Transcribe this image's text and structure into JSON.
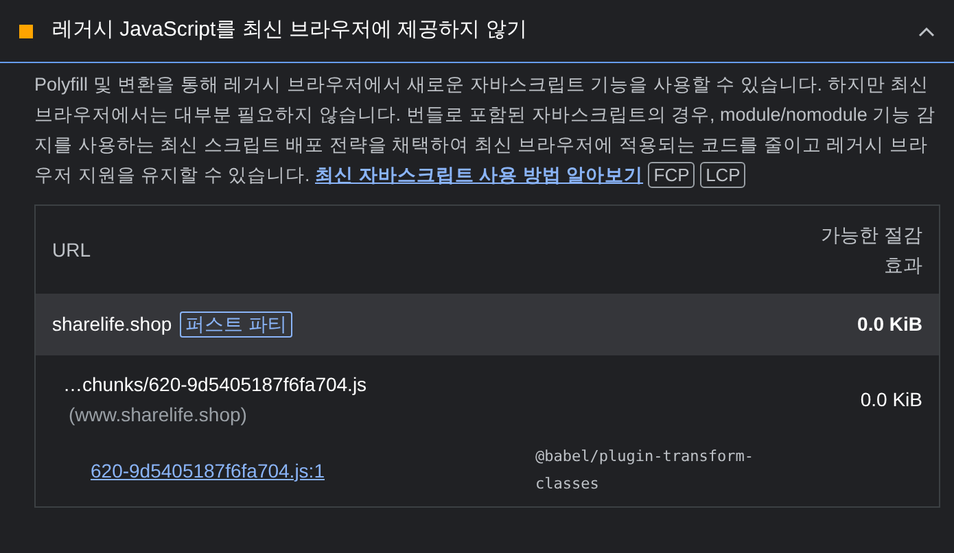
{
  "audit": {
    "title": "레거시 JavaScript를 최신 브라우저에 제공하지 않기",
    "expanded": true,
    "passed": false
  },
  "description": {
    "text": "Polyfill 및 변환을 통해 레거시 브라우저에서 새로운 자바스크립트 기능을 사용할 수 있습니다. 하지만 최신 브라우저에서는 대부분 필요하지 않습니다. 번들로 포함된 자바스크립트의 경우, module/nomodule 기능 감지를 사용하는 최신 스크립트 배포 전략을 채택하여 최신 브라우저에 적용되는 코드를 줄이고 레거시 브라우저 지원을 유지할 수 있습니다.",
    "link": "최신 자바스크립트 사용 방법 알아보기",
    "tags": [
      "FCP",
      "LCP"
    ]
  },
  "table": {
    "columns": [
      "URL",
      "가능한 절감 효과"
    ],
    "group": {
      "entity": "sharelife.shop",
      "badge": "퍼스트 파티",
      "savings": "0.0 KiB"
    },
    "rows": [
      {
        "file": "…chunks/620-9d5405187f6fa704.js",
        "origin": "(www.sharelife.shop)",
        "savings": "0.0 KiB",
        "sub": {
          "location": "620-9d5405187f6fa704.js:1",
          "plugin": "@babel/plugin-transform-classes"
        }
      }
    ]
  }
}
